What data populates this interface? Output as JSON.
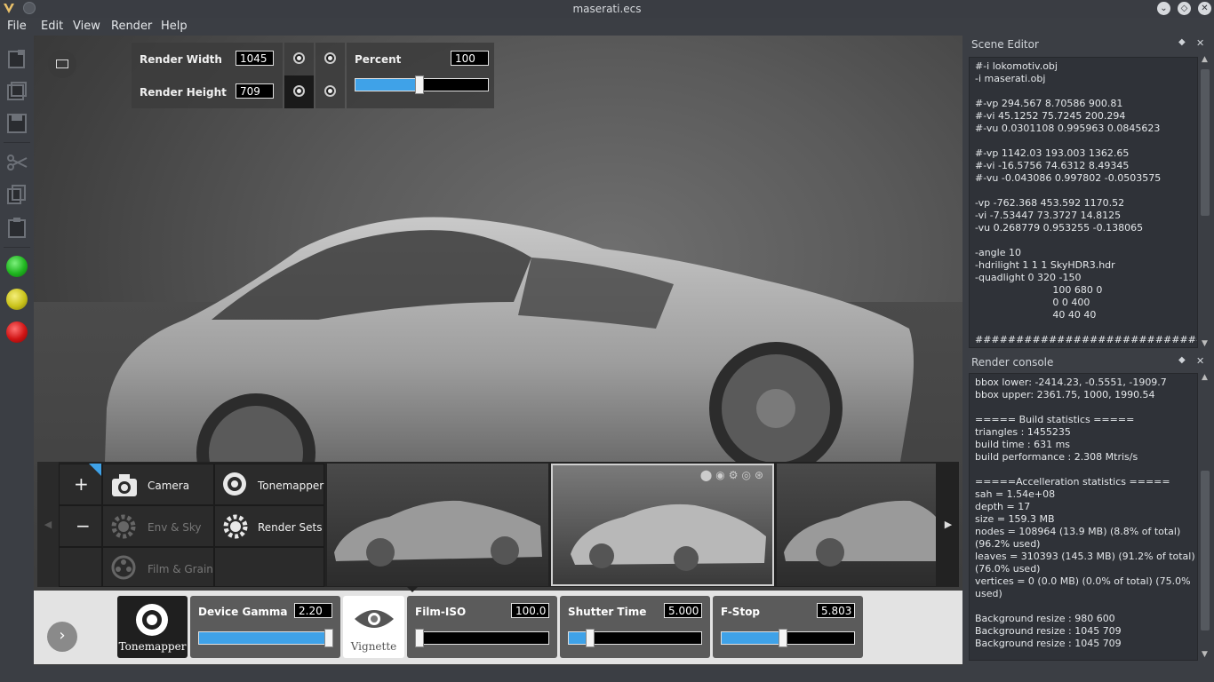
{
  "window": {
    "title": "maserati.ecs"
  },
  "menu": {
    "file": "File",
    "edit": "Edit",
    "view": "View",
    "render": "Render",
    "help": "Help"
  },
  "render_settings": {
    "width_label": "Render Width",
    "width_value": "1045",
    "height_label": "Render Height",
    "height_value": "709",
    "percent_label": "Percent",
    "percent_value": "100",
    "percent_fraction": 0.48
  },
  "tool_panel": {
    "camera": "Camera",
    "tonemapper": "Tonemapper",
    "env_sky": "Env & Sky",
    "render_sets": "Render Sets",
    "film_grain": "Film & Grain",
    "add": "+",
    "remove": "−"
  },
  "controls": {
    "tonemapper_label": "Tonemapper",
    "vignette_label": "Vignette",
    "device_gamma": {
      "label": "Device Gamma",
      "value": "2.20",
      "fraction": 0.98
    },
    "film_iso": {
      "label": "Film-ISO",
      "value": "100.0",
      "fraction": 0.03
    },
    "shutter_time": {
      "label": "Shutter Time",
      "value": "5.000",
      "fraction": 0.16
    },
    "f_stop": {
      "label": "F-Stop",
      "value": "5.803",
      "fraction": 0.46
    }
  },
  "scene_editor": {
    "title": "Scene Editor",
    "text": "#-i lokomotiv.obj\n-i maserati.obj\n\n#-vp 294.567 8.70586 900.81\n#-vi 45.1252 75.7245 200.294\n#-vu 0.0301108 0.995963 0.0845623\n\n#-vp 1142.03 193.003 1362.65\n#-vi -16.5756 74.6312 8.49345\n#-vu -0.043086 0.997802 -0.0503575\n\n-vp -762.368 453.592 1170.52\n-vi -7.53447 73.3727 14.8125\n-vu 0.268779 0.953255 -0.138065\n\n-angle 10\n-hdrilight 1 1 1 SkyHDR3.hdr\n-quadlight 0 320 -150\n                         100 680 0\n                         0 0 400\n                         40 40 40\n\n####################################"
  },
  "render_console": {
    "title": "Render console",
    "text": "bbox lower: -2414.23, -0.5551, -1909.7\nbbox upper: 2361.75, 1000, 1990.54\n\n===== Build statistics =====\ntriangles : 1455235\nbuild time : 631 ms\nbuild performance : 2.308 Mtris/s\n\n=====Accelleration statistics =====\nsah = 1.54e+08\ndepth = 17\nsize = 159.3 MB\nnodes = 108964 (13.9 MB) (8.8% of total)\n(96.2% used)\nleaves = 310393 (145.3 MB) (91.2% of total)\n(76.0% used)\nvertices = 0 (0.0 MB) (0.0% of total) (75.0%\nused)\n\nBackground resize : 980 600\nBackground resize : 1045 709\nBackground resize : 1045 709"
  },
  "colors": {
    "accent": "#3fa2e8",
    "green": "#1fb51f",
    "yellow": "#c9c21a",
    "red": "#d01414"
  }
}
